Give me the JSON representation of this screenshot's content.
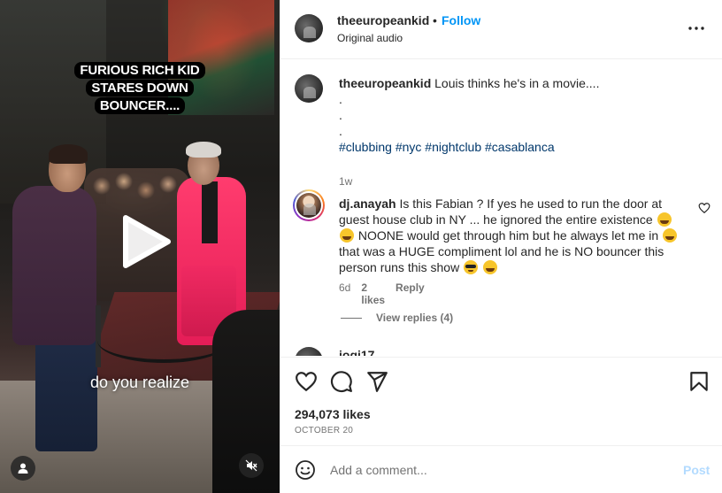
{
  "video": {
    "overlay_title": "FURIOUS RICH KID STARES DOWN BOUNCER....",
    "subtitle": "do you realize"
  },
  "header": {
    "username": "theeuropeankid",
    "separator": "•",
    "follow_label": "Follow",
    "audio_label": "Original audio"
  },
  "caption": {
    "username": "theeuropeankid",
    "text": "Louis thinks he's in a movie....",
    "dots": [
      ".",
      ".",
      "."
    ],
    "hashtags": [
      "#clubbing",
      "#nyc",
      "#nightclub",
      "#casablanca"
    ],
    "age": "1w"
  },
  "comments": [
    {
      "username": "dj.anayah",
      "text_1": "Is this Fabian ? If yes he used to run the door at guest house club in NY ... he ignored the entire existence",
      "text_2": "NOONE would get through him but he always let me in",
      "text_3": "that was a HUGE compliment lol and he is NO bouncer this person runs this show",
      "age": "6d",
      "likes": "2 likes",
      "reply_label": "Reply",
      "view_replies": "View replies (4)"
    }
  ],
  "partial_comment": {
    "username": "jogi17"
  },
  "actions": {
    "likes": "294,073 likes",
    "date": "OCTOBER 20"
  },
  "composer": {
    "placeholder": "Add a comment...",
    "post_label": "Post"
  },
  "colors": {
    "accent": "#0095f6",
    "hashtag": "#00376b",
    "muted": "#737373",
    "post_disabled": "#b3dbff",
    "video_suit": "#ff2f66"
  },
  "icons": [
    "play-icon",
    "user-tag-icon",
    "mute-icon",
    "more-icon",
    "heart-icon",
    "comment-icon",
    "share-icon",
    "save-icon",
    "emoji-icon"
  ]
}
